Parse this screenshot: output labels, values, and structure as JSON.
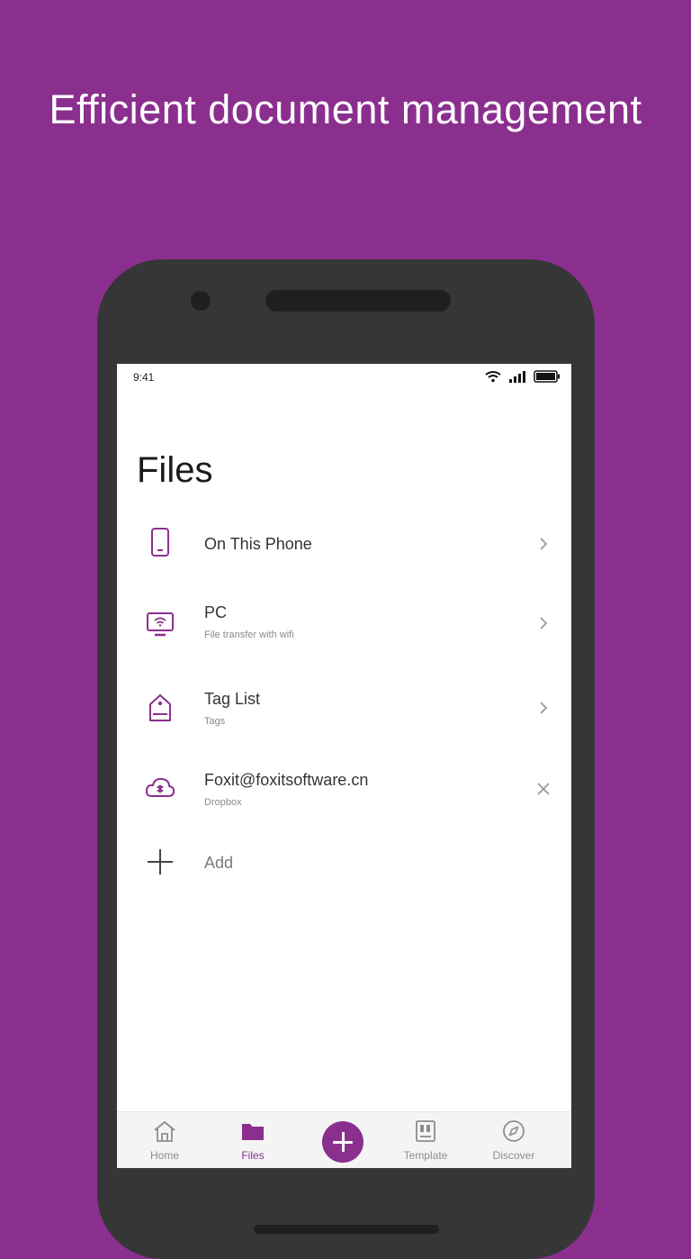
{
  "headline": "Efficient document management",
  "status_bar": {
    "time": "9:41",
    "icons": [
      "wifi-icon",
      "signal-icon",
      "battery-icon"
    ]
  },
  "page": {
    "title": "Files"
  },
  "locations": [
    {
      "icon": "phone-icon",
      "title": "On This Phone",
      "subtitle": "",
      "action": "chevron-right-icon"
    },
    {
      "icon": "monitor-icon",
      "title": "PC",
      "subtitle": "File transfer with wifi",
      "action": "chevron-right-icon"
    },
    {
      "icon": "tag-icon",
      "title": "Tag List",
      "subtitle": "Tags",
      "action": "chevron-right-icon"
    },
    {
      "icon": "cloud-dropbox-icon",
      "title": "Foxit@foxitsoftware.cn",
      "subtitle": "Dropbox",
      "action": "close-icon"
    }
  ],
  "add_item": {
    "icon": "plus-icon",
    "label": "Add"
  },
  "bottom_nav": {
    "items": [
      {
        "label": "Home",
        "icon": "home-icon",
        "active": false
      },
      {
        "label": "Files",
        "icon": "folder-icon",
        "active": true
      },
      {
        "label": "Template",
        "icon": "template-icon",
        "active": false
      },
      {
        "label": "Discover",
        "icon": "compass-icon",
        "active": false
      }
    ],
    "fab_icon": "plus-icon"
  },
  "colors": {
    "brand": "#8b2f8f",
    "phone_body": "#363636",
    "text_primary": "#333333",
    "text_secondary": "#8a8a8a"
  }
}
